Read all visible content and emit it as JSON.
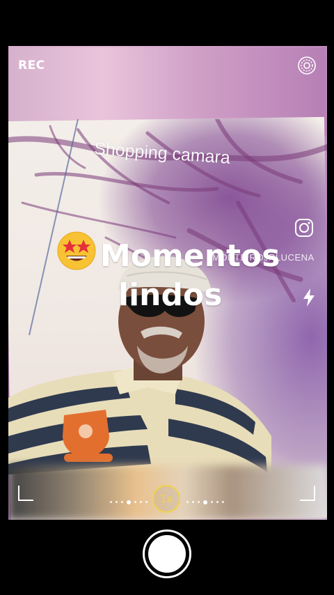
{
  "camera": {
    "rec_label": "REC",
    "zoom_label": "1x",
    "accent_color": "#f2d24a"
  },
  "overlays": {
    "shopping_text": "Shopping camara",
    "handle_text": "MONTEIROJRLUCENA",
    "caption_line1": "Momentos",
    "caption_line2": "lindos",
    "caption_emoji": "star-struck-emoji"
  },
  "icons": {
    "settings": "settings-ring-icon",
    "instagram": "instagram-icon",
    "flash": "flash-icon",
    "shutter": "shutter-button"
  }
}
